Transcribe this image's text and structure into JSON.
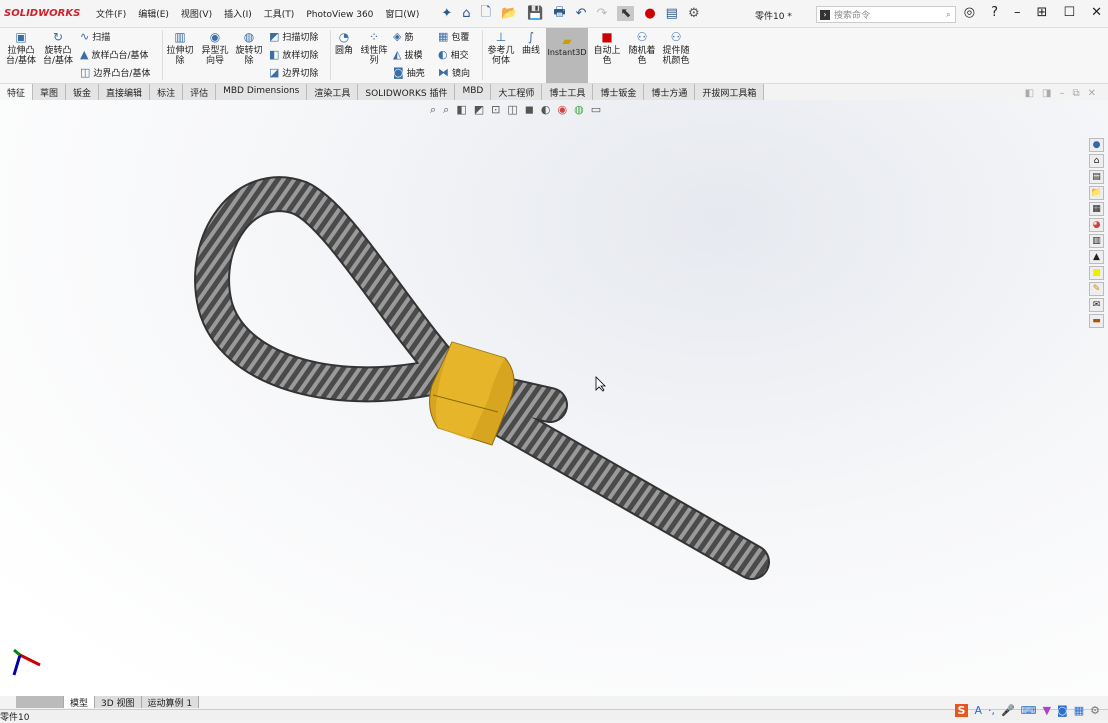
{
  "app": {
    "logo": "SOLIDWORKS",
    "document": "零件10 *"
  },
  "menu": [
    "文件(F)",
    "编辑(E)",
    "视图(V)",
    "插入(I)",
    "工具(T)",
    "PhotoView 360",
    "窗口(W)"
  ],
  "search": {
    "placeholder": "搜索命令"
  },
  "ribbon": {
    "extrude_boss": "拉伸凸台/基体",
    "revolve_boss": "旋转凸台/基体",
    "sweep": "扫描",
    "loft": "放样凸台/基体",
    "boundary": "边界凸台/基体",
    "extrude_cut": "拉伸切除",
    "hole_wizard": "异型孔向导",
    "revolve_cut": "旋转切除",
    "swept_cut": "扫描切除",
    "lofted_cut": "放样切除",
    "boundary_cut": "边界切除",
    "fillet": "圆角",
    "linear_pattern": "线性阵列",
    "rib": "筋",
    "draft": "拔模",
    "shell": "抽壳",
    "wrap": "包覆",
    "intersect": "相交",
    "mirror": "镜向",
    "ref_geometry": "参考几何体",
    "curves": "曲线",
    "instant3d": "Instant3D",
    "auto_color": "自动上色",
    "random_color": "随机着色",
    "part_random_color": "提件随机颜色"
  },
  "tabs": [
    "特征",
    "草图",
    "钣金",
    "直接编辑",
    "标注",
    "评估",
    "MBD Dimensions",
    "渲染工具",
    "SOLIDWORKS 插件",
    "MBD",
    "大工程师",
    "博士工具",
    "博士钣金",
    "博士方通",
    "开拔网工具箱"
  ],
  "bottom_tabs": [
    "模型",
    "3D 视图",
    "运动算例 1"
  ],
  "status": "零件10",
  "colors": {
    "sleeve": "#d8a520",
    "rope": "#5a5a5a",
    "accent": "#d0202a"
  }
}
